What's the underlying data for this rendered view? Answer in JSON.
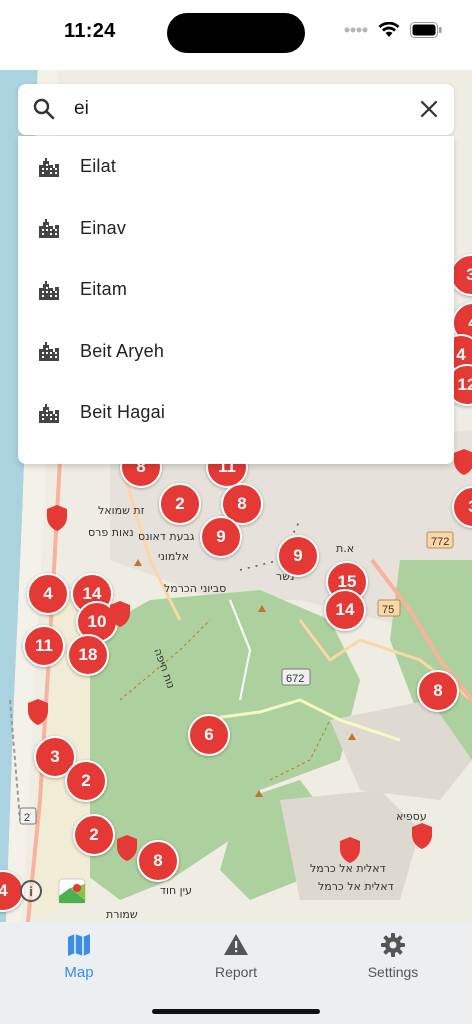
{
  "status_bar": {
    "time": "11:24"
  },
  "search": {
    "value": "ei",
    "results": [
      {
        "label": "Eilat",
        "icon": "city-icon"
      },
      {
        "label": "Einav",
        "icon": "city-icon"
      },
      {
        "label": "Eitam",
        "icon": "city-icon"
      },
      {
        "label": "Beit Aryeh",
        "icon": "city-icon"
      },
      {
        "label": "Beit Hagai",
        "icon": "city-icon"
      }
    ]
  },
  "map": {
    "clusters": [
      "8",
      "11",
      "2",
      "8",
      "9",
      "9",
      "15",
      "14",
      "4",
      "14",
      "10",
      "11",
      "18",
      "6",
      "3",
      "2",
      "2",
      "8",
      "8",
      "3",
      "4",
      "4",
      "12",
      "3",
      "4"
    ],
    "road_labels": [
      "772",
      "75",
      "672"
    ],
    "place_labels": [
      "נאות פרס",
      "זת שמואל",
      "גבעת דאונס",
      "אלמוני",
      "סביוני הכרמל",
      "נשר",
      "א.ת",
      "נות חיפה",
      "עספיא",
      "דאלית אל כרמל",
      "דאלית אל כרמל",
      "עין חוד",
      "שמורת"
    ],
    "info_icon": "i",
    "accent": "#e53935"
  },
  "nav": {
    "items": [
      {
        "label": "Map",
        "icon": "map-icon",
        "active": true
      },
      {
        "label": "Report",
        "icon": "warning-icon",
        "active": false
      },
      {
        "label": "Settings",
        "icon": "gear-icon",
        "active": false
      }
    ],
    "active_color": "#3a8ee6"
  }
}
